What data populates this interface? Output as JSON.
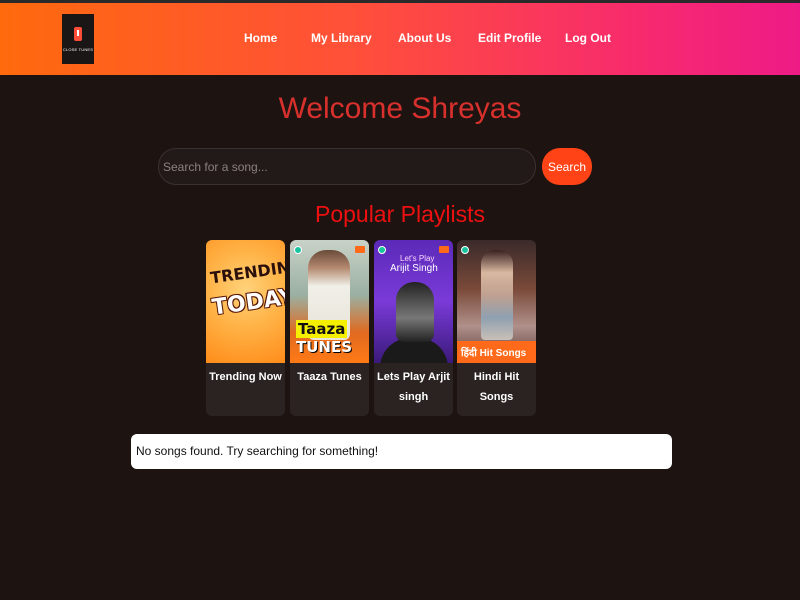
{
  "logo": {
    "text": "CLOSE TUNES"
  },
  "nav": {
    "items": [
      {
        "label": "Home"
      },
      {
        "label": "My Library"
      },
      {
        "label": "About Us"
      },
      {
        "label": "Edit Profile"
      },
      {
        "label": "Log Out"
      }
    ]
  },
  "welcome": "Welcome Shreyas",
  "search": {
    "placeholder": "Search for a song...",
    "button_label": "Search"
  },
  "playlists": {
    "title": "Popular Playlists",
    "items": [
      {
        "title": "Trending Now",
        "art_line1": "TRENDING",
        "art_line2": "TODAY"
      },
      {
        "title": "Taaza Tunes",
        "art_line1": "Taaza",
        "art_line2": "TUNES"
      },
      {
        "title": "Lets Play Arjit singh",
        "art_line1": "Let's Play",
        "art_line2": "Arijit Singh"
      },
      {
        "title": "Hindi Hit Songs",
        "art_line1": "हिंदी Hit Songs"
      }
    ]
  },
  "results": {
    "empty_message": "No songs found. Try searching for something!"
  },
  "colors": {
    "accent": "#ff4316",
    "welcome": "#d8302c",
    "section_title": "#ee1010",
    "background": "#1d1412"
  }
}
